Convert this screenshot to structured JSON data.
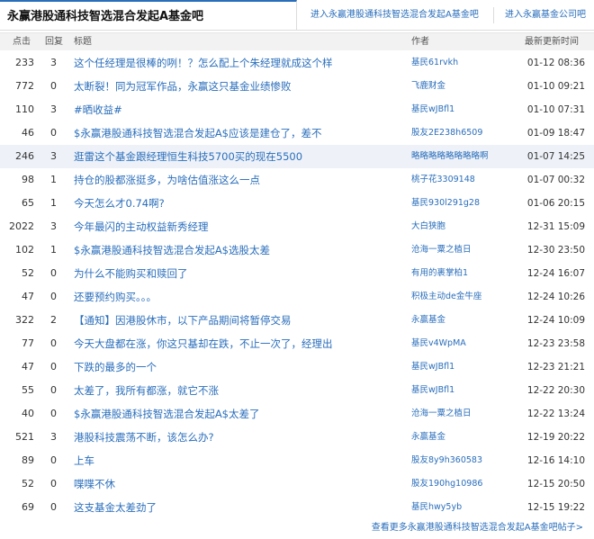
{
  "header": {
    "title": "永赢港股通科技智选混合发起A基金吧",
    "link_forum": "进入永赢港股通科技智选混合发起A基金吧",
    "link_company": "进入永赢基金公司吧"
  },
  "columns": {
    "clicks": "点击",
    "replies": "回复",
    "title": "标题",
    "author": "作者",
    "updated": "最新更新时间"
  },
  "posts": [
    {
      "clicks": "233",
      "replies": "3",
      "title": "这个任经理是很棒的咧！？怎么配上个朱经理就成这个样",
      "author": "基民61rvkh",
      "updated": "01-12 08:36"
    },
    {
      "clicks": "772",
      "replies": "0",
      "title": "太断裂！同为冠军作品，永赢这只基金业绩惨败",
      "author": "飞鹿财金",
      "updated": "01-10 09:21"
    },
    {
      "clicks": "110",
      "replies": "3",
      "title": "#晒收益#",
      "author": "基民wJBfl1",
      "updated": "01-10 07:31"
    },
    {
      "clicks": "46",
      "replies": "0",
      "title": "$永赢港股通科技智选混合发起A$应该是建仓了，差不",
      "author": "股友2E238h6509",
      "updated": "01-09 18:47"
    },
    {
      "clicks": "246",
      "replies": "3",
      "title": "逛雷这个基金跟经理恒生科技5700买的现在5500",
      "author": "略略略略略略略略啊",
      "updated": "01-07 14:25"
    },
    {
      "clicks": "98",
      "replies": "1",
      "title": "持仓的股都涨挺多，为啥估值涨这么一点",
      "author": "桃子花3309148",
      "updated": "01-07 00:32"
    },
    {
      "clicks": "65",
      "replies": "1",
      "title": "今天怎么才0.74啊?",
      "author": "基民930l291g28",
      "updated": "01-06 20:15"
    },
    {
      "clicks": "2022",
      "replies": "3",
      "title": "今年最闪的主动权益新秀经理",
      "author": "大白狭胞",
      "updated": "12-31 15:09"
    },
    {
      "clicks": "102",
      "replies": "1",
      "title": "$永赢港股通科技智选混合发起A$选股太差",
      "author": "沧海一粟之植日",
      "updated": "12-30 23:50"
    },
    {
      "clicks": "52",
      "replies": "0",
      "title": "为什么不能购买和赎回了",
      "author": "有用的裹掌柏1",
      "updated": "12-24 16:07"
    },
    {
      "clicks": "47",
      "replies": "0",
      "title": "还要预约购买。。。",
      "author": "积极主动de金牛座",
      "updated": "12-24 10:26"
    },
    {
      "clicks": "322",
      "replies": "2",
      "title": "【通知】因港股休市，以下产品期间将暂停交易",
      "author": "永赢基金",
      "updated": "12-24 10:09"
    },
    {
      "clicks": "77",
      "replies": "0",
      "title": "今天大盘都在涨，你这只基却在跌，不止一次了，经理出",
      "author": "基民v4WpMA",
      "updated": "12-23 23:58"
    },
    {
      "clicks": "47",
      "replies": "0",
      "title": "下跌的最多的一个",
      "author": "基民wJBfl1",
      "updated": "12-23 21:21"
    },
    {
      "clicks": "55",
      "replies": "0",
      "title": "太差了，我所有都涨，就它不涨",
      "author": "基民wJBfl1",
      "updated": "12-22 20:30"
    },
    {
      "clicks": "40",
      "replies": "0",
      "title": "$永赢港股通科技智选混合发起A$太差了",
      "author": "沧海一粟之植日",
      "updated": "12-22 13:24"
    },
    {
      "clicks": "521",
      "replies": "3",
      "title": "港股科技震荡不断，该怎么办?",
      "author": "永赢基金",
      "updated": "12-19 20:22"
    },
    {
      "clicks": "89",
      "replies": "0",
      "title": "上车",
      "author": "股友8y9h360583",
      "updated": "12-16 14:10"
    },
    {
      "clicks": "52",
      "replies": "0",
      "title": "喋喋不休",
      "author": "股友190hg10986",
      "updated": "12-15 20:50"
    },
    {
      "clicks": "69",
      "replies": "0",
      "title": "这支基金太差劲了",
      "author": "基民hwy5yb",
      "updated": "12-15 19:22"
    }
  ],
  "highlighted_row": 4,
  "footer": {
    "more_link": "查看更多永赢港股通科技智选混合发起A基金吧帖子>"
  },
  "colors": {
    "link": "#2a6ebb",
    "header_bg": "#f2f2f2",
    "highlight_bg": "#eef2f8"
  }
}
